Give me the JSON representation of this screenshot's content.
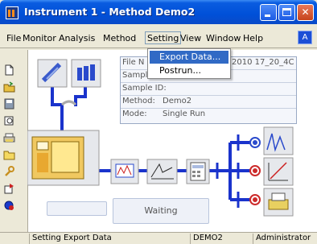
{
  "window": {
    "title": "Instrument 1 - Method Demo2",
    "controls": [
      "minimize",
      "maximize",
      "close"
    ]
  },
  "menubar": {
    "items": [
      "File",
      "Monitor",
      "Analysis",
      "Method",
      "Setting",
      "View",
      "Window",
      "Help"
    ],
    "open_menu": "Setting",
    "help_icon": "A"
  },
  "dropdown": {
    "items": [
      "Export Data...",
      "Postrun..."
    ],
    "selected": "Export Data..."
  },
  "toolbar": {
    "icons": [
      "new-document-icon",
      "open-folder-icon",
      "save-disk-icon",
      "print-preview-icon",
      "print-icon",
      "folder-icon",
      "wrench-icon",
      "run-icon",
      "settings-icon"
    ]
  },
  "info_panel": {
    "rows": [
      {
        "label": "File N",
        "value": "",
        "tail": "2010 17_20_4C"
      },
      {
        "label": "Sampler",
        "value": "",
        "tail": ""
      },
      {
        "label": "Sample ID:",
        "value": "",
        "tail": ""
      },
      {
        "label": "Method:",
        "value": "Demo2",
        "tail": ""
      },
      {
        "label": "Mode:",
        "value": "Single Run",
        "tail": ""
      }
    ]
  },
  "status_box": {
    "text": "Waiting"
  },
  "statusbar": {
    "message": "Setting Export Data",
    "method": "DEMO2",
    "user": "Administrator"
  },
  "colors": {
    "titlebar": "#0a5ce0",
    "pipe": "#1a33cc",
    "selection": "#316ac5",
    "valve_red": "#cc2a2a"
  }
}
